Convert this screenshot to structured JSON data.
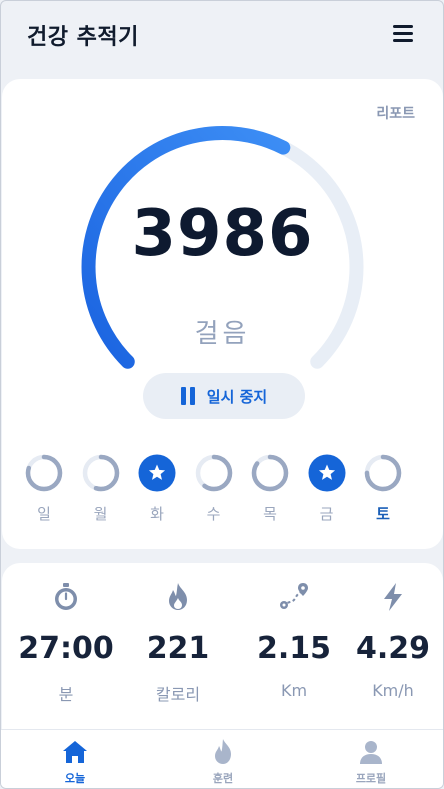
{
  "header": {
    "title": "건강 추적기",
    "menu_icon": "hamburger-menu-icon"
  },
  "tracker": {
    "report_label": "리포트",
    "steps": "3986",
    "steps_unit": "걸음",
    "progress_fraction": 0.6,
    "pause_label": "일시 중지",
    "colors": {
      "accent": "#1565d8",
      "track": "#e8eef6"
    }
  },
  "week": {
    "days": [
      {
        "label": "일",
        "progress": 0.8,
        "starred": false,
        "today": false
      },
      {
        "label": "월",
        "progress": 0.55,
        "starred": false,
        "today": false
      },
      {
        "label": "화",
        "progress": 1.0,
        "starred": true,
        "today": false
      },
      {
        "label": "수",
        "progress": 0.6,
        "starred": false,
        "today": false
      },
      {
        "label": "목",
        "progress": 0.85,
        "starred": false,
        "today": false
      },
      {
        "label": "금",
        "progress": 1.0,
        "starred": true,
        "today": false
      },
      {
        "label": "토",
        "progress": 0.75,
        "starred": false,
        "today": true
      }
    ]
  },
  "stats": [
    {
      "icon": "stopwatch-icon",
      "value": "27:00",
      "unit": "분"
    },
    {
      "icon": "flame-icon",
      "value": "221",
      "unit": "칼로리"
    },
    {
      "icon": "route-icon",
      "value": "2.15",
      "unit": "Km"
    },
    {
      "icon": "bolt-icon",
      "value": "4.29",
      "unit": "Km/h"
    }
  ],
  "tabs": [
    {
      "icon": "home-icon",
      "label": "오늘",
      "active": true
    },
    {
      "icon": "flame-icon",
      "label": "훈련",
      "active": false
    },
    {
      "icon": "user-icon",
      "label": "프로필",
      "active": false
    }
  ]
}
